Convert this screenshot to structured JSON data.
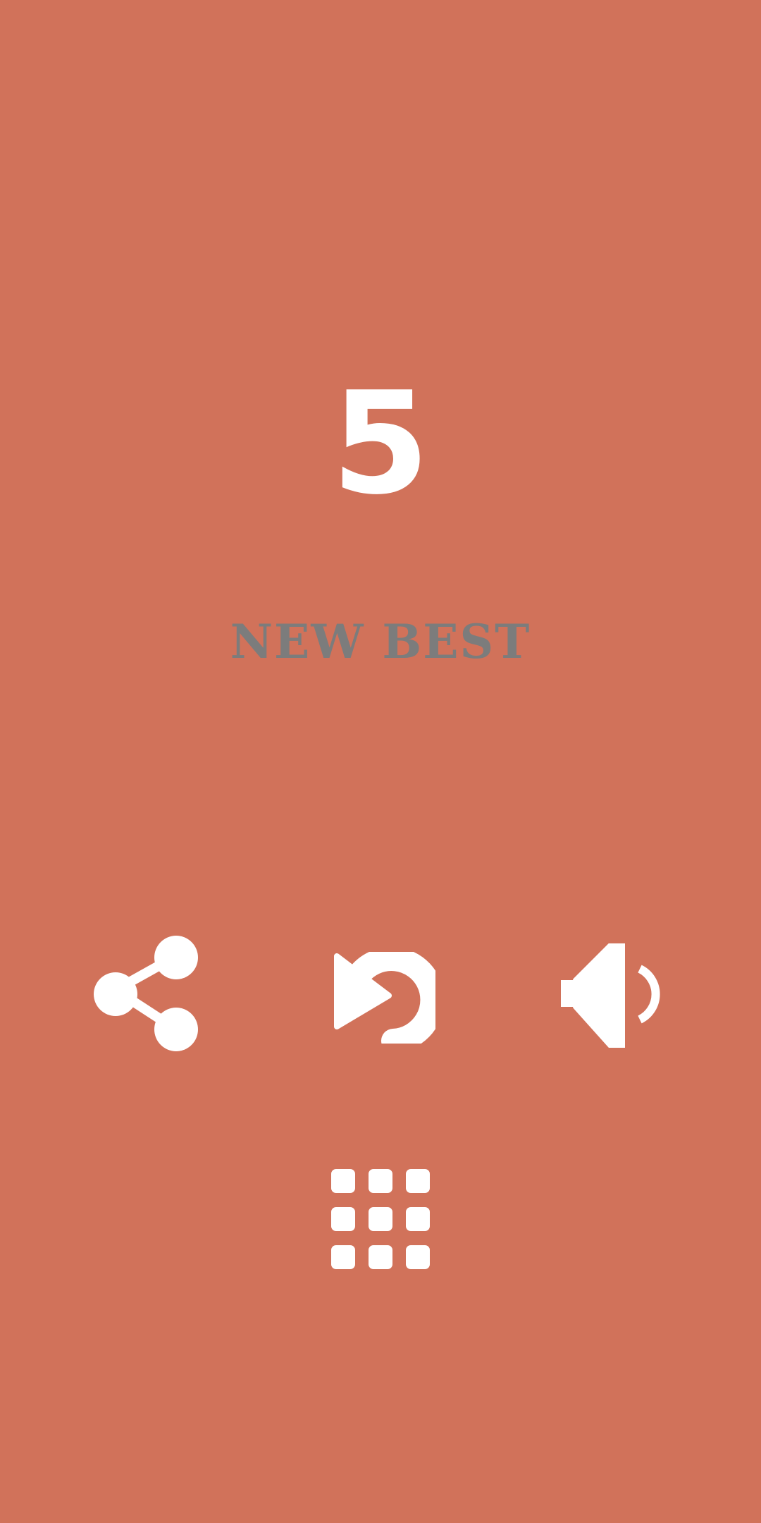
{
  "game": {
    "score": "5",
    "new_best_label": "NEW BEST"
  },
  "colors": {
    "background": "#D1725A",
    "score_text": "#FFFFFF",
    "new_best_text": "#7C7C7C",
    "icon": "#FFFFFF"
  },
  "icons": {
    "share": "share-icon",
    "replay": "replay-icon",
    "sound": "sound-icon",
    "levels": "grid-icon"
  }
}
